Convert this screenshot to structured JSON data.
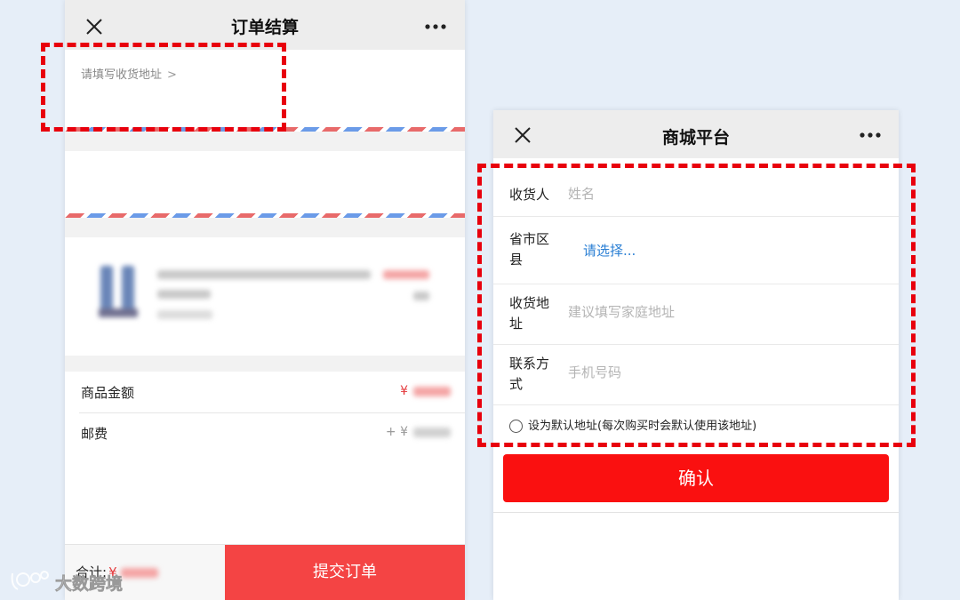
{
  "left_screen": {
    "title": "订单结算",
    "address_prompt": "请填写收货地址",
    "summary": {
      "goods_amount_label": "商品金额",
      "goods_amount_currency": "¥",
      "shipping_label": "邮费",
      "shipping_prefix": "+ ¥"
    },
    "bottom_bar": {
      "total_label": "合计:",
      "total_currency": "¥",
      "submit_label": "提交订单"
    }
  },
  "right_screen": {
    "title": "商城平台",
    "form": {
      "recipient_label": "收货人",
      "recipient_placeholder": "姓名",
      "region_label": "省市区县",
      "region_value": "请选择...",
      "address_label": "收货地址",
      "address_placeholder": "建议填写家庭地址",
      "contact_label": "联系方式",
      "contact_placeholder": "手机号码",
      "default_address_label": "设为默认地址(每次购买时会默认使用该地址)"
    },
    "confirm_label": "确认"
  },
  "watermark": "大数跨境",
  "colors": {
    "accent_red": "#f44444",
    "confirm_red": "#fa1010",
    "price_red": "#e4393c",
    "link_blue": "#2a7fd4",
    "highlight_red": "#e8000d",
    "background": "#e6eef8"
  },
  "icons": [
    "close-icon",
    "more-icon",
    "chevron-right-icon",
    "radio-icon",
    "watermark-logo-icon"
  ]
}
